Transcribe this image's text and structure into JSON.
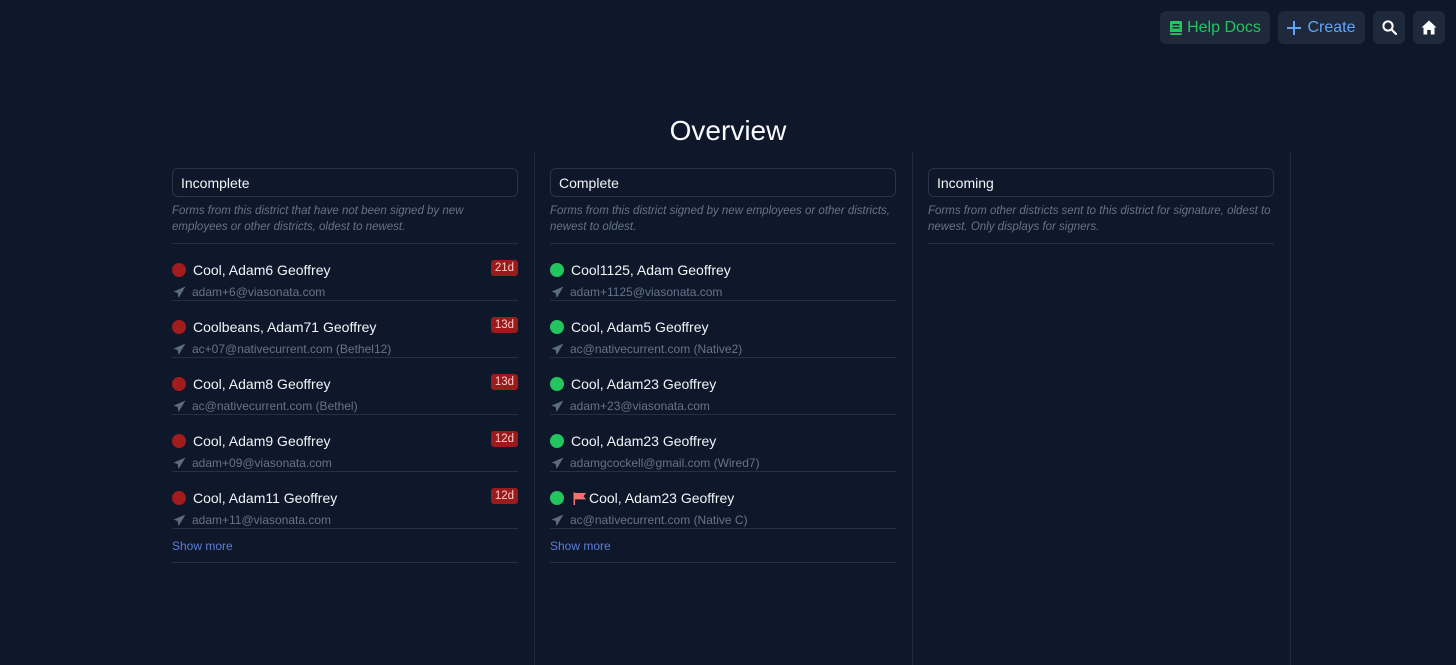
{
  "topbar": {
    "help_label": "Help Docs",
    "create_label": "Create",
    "help_color": "#22c55e",
    "create_color": "#60a5fa"
  },
  "page": {
    "title": "Overview"
  },
  "columns": [
    {
      "title": "Incomplete",
      "description": "Forms from this district that have not been signed by new employees or other districts, oldest to newest.",
      "show_more": "Show more",
      "rows": [
        {
          "name": "Cool, Adam6 Geoffrey",
          "email": "adam+6@viasonata.com",
          "badge": "21d",
          "status": "red"
        },
        {
          "name": "Coolbeans, Adam71 Geoffrey",
          "email": "ac+07@nativecurrent.com (Bethel12)",
          "badge": "13d",
          "status": "red"
        },
        {
          "name": "Cool, Adam8 Geoffrey",
          "email": "ac@nativecurrent.com (Bethel)",
          "badge": "13d",
          "status": "red"
        },
        {
          "name": "Cool, Adam9 Geoffrey",
          "email": "adam+09@viasonata.com",
          "badge": "12d",
          "status": "red"
        },
        {
          "name": "Cool, Adam11 Geoffrey",
          "email": "adam+11@viasonata.com",
          "badge": "12d",
          "status": "red"
        }
      ]
    },
    {
      "title": "Complete",
      "description": "Forms from this district signed by new employees or other districts, newest to oldest.",
      "show_more": "Show more",
      "rows": [
        {
          "name": "Cool1125, Adam Geoffrey",
          "email": "adam+1125@viasonata.com",
          "status": "green"
        },
        {
          "name": "Cool, Adam5 Geoffrey",
          "email": "ac@nativecurrent.com (Native2)",
          "status": "green"
        },
        {
          "name": "Cool, Adam23 Geoffrey",
          "email": "adam+23@viasonata.com",
          "status": "green"
        },
        {
          "name": "Cool, Adam23 Geoffrey",
          "email": "adamgcockell@gmail.com (Wired7)",
          "status": "green"
        },
        {
          "name": "Cool, Adam23 Geoffrey",
          "email": "ac@nativecurrent.com (Native C)",
          "status": "green",
          "flagged": true
        }
      ]
    },
    {
      "title": "Incoming",
      "description": "Forms from other districts sent to this district for signature, oldest to newest. Only displays for signers.",
      "rows": []
    }
  ],
  "colors": {
    "background": "#0f172a",
    "incomplete_dot": "#a11c1c",
    "complete_dot": "#22c55e",
    "badge_bg": "#991b1b",
    "flag": "#f87171"
  }
}
